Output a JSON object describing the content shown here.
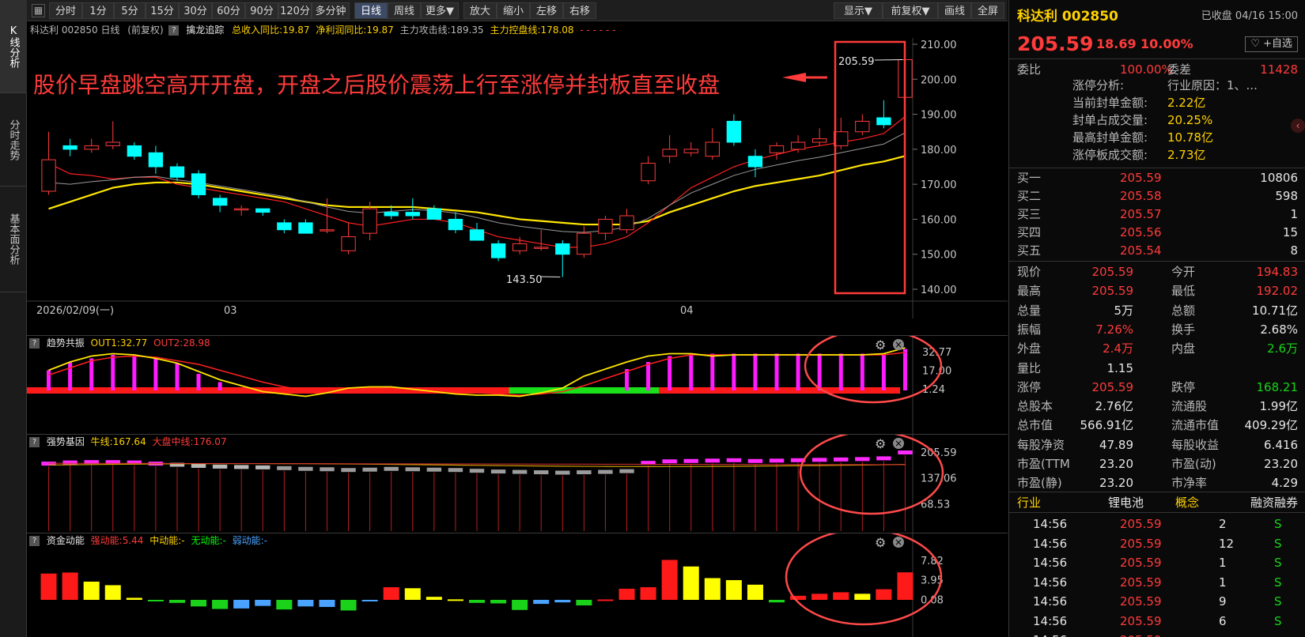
{
  "left_sidebar": [
    "K线分析",
    "分时走势",
    "基本面分析"
  ],
  "toolbar": {
    "items": [
      "分时",
      "1分",
      "5分",
      "15分",
      "30分",
      "60分",
      "90分",
      "120分",
      "多分钟",
      "日线",
      "周线",
      "更多▼",
      "放大",
      "缩小",
      "左移",
      "右移"
    ],
    "right_items": [
      "显示▼",
      "前复权▼",
      "画线",
      "全屏"
    ]
  },
  "chart_header": {
    "name": "科达利 002850 日线",
    "adj": "(前复权)",
    "indicator": "擒龙追踪",
    "rev": "总收入同比:19.87",
    "profit": "净利润同比:19.87",
    "atk": "主力攻击线:189.35",
    "ctrl": "主力控盘线:178.08",
    "dots": "- - - - - -"
  },
  "annotation": "股价早盘跳空高开开盘，开盘之后股价震荡上行至涨停并封板直至收盘",
  "price_axis": [
    "210.00",
    "200.00",
    "190.00",
    "180.00",
    "170.00",
    "160.00",
    "150.00",
    "140.00"
  ],
  "date_axis": [
    "2026/02/09(一)",
    "03",
    "04"
  ],
  "price_labels": {
    "last_high": "205.59",
    "low": "143.50"
  },
  "chart_data": [
    {
      "type": "candlestick",
      "name": "K线",
      "price_range": [
        140,
        210
      ],
      "candles": [
        [
          168,
          177,
          167,
          185
        ],
        [
          181,
          180,
          178,
          183
        ],
        [
          180,
          181,
          179,
          183
        ],
        [
          181,
          182,
          180,
          188
        ],
        [
          181,
          178,
          177,
          182
        ],
        [
          179,
          175,
          173,
          181
        ],
        [
          175,
          172,
          171,
          176
        ],
        [
          173,
          167,
          166,
          174
        ],
        [
          166,
          164,
          162,
          167
        ],
        [
          163,
          163,
          161,
          164
        ],
        [
          163,
          162,
          161,
          163
        ],
        [
          159,
          157,
          156,
          160
        ],
        [
          159,
          156,
          156,
          160
        ],
        [
          157,
          157,
          156,
          166
        ],
        [
          151,
          155,
          150,
          159
        ],
        [
          156,
          163,
          154,
          165
        ],
        [
          162,
          161,
          160,
          164
        ],
        [
          162,
          161,
          160,
          166
        ],
        [
          163,
          160,
          160,
          164
        ],
        [
          160,
          157,
          156,
          162
        ],
        [
          157,
          154,
          154,
          159
        ],
        [
          153,
          149,
          148,
          154
        ],
        [
          151,
          153,
          150,
          155
        ],
        [
          152,
          152,
          151,
          157
        ],
        [
          153,
          150,
          143.5,
          154
        ],
        [
          150,
          156,
          149,
          158
        ],
        [
          156,
          160,
          154,
          161
        ],
        [
          157,
          161,
          156,
          163
        ],
        [
          171,
          176,
          170,
          178
        ],
        [
          178,
          180,
          176,
          184
        ],
        [
          179,
          180,
          178,
          182
        ],
        [
          178,
          182,
          177,
          186
        ],
        [
          188,
          182,
          181,
          190
        ],
        [
          178,
          175,
          172,
          180
        ],
        [
          179,
          181,
          177,
          182
        ],
        [
          180,
          182,
          179,
          184
        ],
        [
          182,
          183,
          181,
          186
        ],
        [
          181,
          185,
          180,
          189
        ],
        [
          185,
          188,
          184,
          190
        ],
        [
          189,
          187,
          186,
          194
        ],
        [
          194.83,
          205.59,
          192.02,
          205.59
        ]
      ],
      "ma5": [
        176,
        173,
        172.5,
        171.5,
        172,
        172,
        170,
        169,
        168,
        167,
        166,
        165,
        163,
        161,
        159,
        158,
        159,
        160,
        160,
        159,
        157,
        155,
        154,
        153,
        152,
        152,
        153,
        155,
        159,
        164,
        169,
        172,
        175,
        177,
        178.5,
        180,
        181,
        182,
        183,
        184.5,
        189.35
      ],
      "ma_yellow": [
        163,
        165,
        167,
        169,
        170,
        170.5,
        170.5,
        170,
        169,
        168,
        167,
        166,
        165,
        164,
        163.5,
        163.5,
        163.5,
        163.5,
        163,
        162.5,
        162,
        161,
        160,
        159.5,
        159,
        158.5,
        158.5,
        158.5,
        159.5,
        162,
        164,
        166,
        168,
        169.5,
        170.5,
        171.5,
        172.5,
        174,
        175.5,
        176.5,
        178.08
      ]
    },
    {
      "type": "bar+line",
      "name": "趋势共振",
      "labels": [
        "OUT1:32.77",
        "OUT2:28.98"
      ],
      "axis": [
        "32.77",
        "17.00",
        "1.24"
      ],
      "bars": [
        17,
        24,
        27,
        30,
        29,
        27,
        23,
        14,
        7,
        0,
        0,
        0,
        0,
        0,
        0,
        0,
        0,
        0,
        0,
        0,
        0,
        0,
        0,
        0,
        0,
        0,
        0,
        18,
        24,
        29,
        31,
        31,
        31,
        31,
        31,
        31,
        31,
        31,
        31,
        31,
        35
      ],
      "out1": [
        17,
        24,
        29,
        31,
        30,
        27,
        23,
        16,
        9,
        4,
        -1,
        -3,
        -5,
        -2,
        2,
        3,
        3,
        1,
        -1,
        -3,
        -4,
        -4,
        -5,
        -2,
        2,
        12,
        18,
        24,
        29,
        31,
        31,
        29,
        30,
        30,
        30,
        30,
        30,
        30,
        30,
        31,
        36
      ],
      "out2": [
        13,
        19,
        25,
        28,
        29,
        28,
        25,
        22,
        17,
        12,
        7,
        3,
        0,
        -2,
        -1,
        1,
        2,
        2,
        1,
        -1,
        -2,
        -3,
        -4,
        -3,
        -1,
        4,
        10,
        16,
        22,
        27,
        30,
        30,
        30,
        30,
        30,
        30,
        30,
        30,
        30,
        30,
        32
      ],
      "green_segment": [
        22,
        28
      ]
    },
    {
      "type": "bar",
      "name": "强势基因",
      "labels": [
        "牛线:167.64",
        "大盘中线:176.07"
      ],
      "axis": [
        "205.59",
        "137.06",
        "68.53"
      ],
      "values": [
        176,
        179,
        180,
        180,
        179,
        176,
        173,
        170,
        168,
        167,
        166,
        164,
        162,
        161,
        159,
        160,
        162,
        161,
        160,
        159,
        157,
        155,
        154,
        153,
        152,
        153,
        154,
        156,
        178,
        182,
        183,
        184,
        185,
        183,
        184,
        185,
        186,
        187,
        188,
        190,
        205.59
      ]
    },
    {
      "type": "bar",
      "name": "资金动能",
      "labels": [
        "强动能:5.44",
        "中动能:-",
        "无动能:-",
        "弱动能:-"
      ],
      "axis": [
        "7.82",
        "3.95",
        "0.08"
      ],
      "values": [
        5.2,
        5.4,
        3.6,
        2.9,
        0.4,
        -0.2,
        -0.6,
        -1.3,
        -1.8,
        -1.7,
        -1.2,
        -1.9,
        -1.3,
        -1.4,
        -2.1,
        -0.3,
        2.5,
        2.3,
        0.6,
        0.1,
        -0.6,
        -0.7,
        -2.0,
        -0.8,
        -0.5,
        -1.1,
        0.08,
        2.2,
        2.5,
        7.9,
        6.6,
        4.3,
        3.9,
        3.0,
        -0.5,
        0.8,
        1.2,
        1.5,
        1.2,
        2.1,
        5.44
      ],
      "colors": [
        "r",
        "r",
        "y",
        "y",
        "y",
        "g",
        "g",
        "g",
        "g",
        "b",
        "b",
        "g",
        "b",
        "b",
        "g",
        "b",
        "r",
        "y",
        "y",
        "y",
        "g",
        "g",
        "g",
        "b",
        "b",
        "g",
        "r",
        "r",
        "r",
        "r",
        "y",
        "y",
        "y",
        "y",
        "g",
        "r",
        "r",
        "r",
        "y",
        "r",
        "r"
      ]
    }
  ],
  "quote": {
    "name": "科达利 002850",
    "status": "已收盘 04/16 15:00",
    "price": "205.59",
    "change": "18.69",
    "pct": "10.00%",
    "fav": "♡ +自选",
    "webi_label": "委比",
    "webi": "100.00%",
    "weicha_label": "委差",
    "weicha": "11428",
    "limit_analysis": [
      {
        "k": "涨停分析:",
        "v": "行业原因：1、..."
      },
      {
        "k": "当前封单金额:",
        "v": "2.22亿"
      },
      {
        "k": "封单占成交量:",
        "v": "20.25%"
      },
      {
        "k": "最高封单金额:",
        "v": "10.78亿"
      },
      {
        "k": "涨停板成交额:",
        "v": "2.73亿"
      }
    ],
    "bids": [
      {
        "k": "买一",
        "p": "205.59",
        "v": "10806"
      },
      {
        "k": "买二",
        "p": "205.58",
        "v": "598"
      },
      {
        "k": "买三",
        "p": "205.57",
        "v": "1"
      },
      {
        "k": "买四",
        "p": "205.56",
        "v": "15"
      },
      {
        "k": "买五",
        "p": "205.54",
        "v": "8"
      }
    ],
    "stats": [
      [
        "现价",
        "205.59",
        "今开",
        "194.83"
      ],
      [
        "最高",
        "205.59",
        "最低",
        "192.02"
      ],
      [
        "总量",
        "5万",
        "总额",
        "10.71亿"
      ],
      [
        "振幅",
        "7.26%",
        "换手",
        "2.68%"
      ],
      [
        "外盘",
        "2.4万",
        "内盘",
        "2.6万"
      ],
      [
        "量比",
        "1.15",
        "",
        ""
      ],
      [
        "涨停",
        "205.59",
        "跌停",
        "168.21"
      ],
      [
        "总股本",
        "2.76亿",
        "流通股",
        "1.99亿"
      ],
      [
        "总市值",
        "566.91亿",
        "流通市值",
        "409.29亿"
      ],
      [
        "每股净资",
        "47.89",
        "每股收益",
        "6.416"
      ],
      [
        "市盈(TTM",
        "23.20",
        "市盈(动)",
        "23.20"
      ],
      [
        "市盈(静)",
        "23.20",
        "市净率",
        "4.29"
      ]
    ],
    "tags": [
      "行业",
      "锂电池",
      "概念",
      "融资融券"
    ],
    "ticks": [
      [
        "14:56",
        "205.59",
        "2",
        "S"
      ],
      [
        "14:56",
        "205.59",
        "12",
        "S"
      ],
      [
        "14:56",
        "205.59",
        "1",
        "S"
      ],
      [
        "14:56",
        "205.59",
        "1",
        "S"
      ],
      [
        "14:56",
        "205.59",
        "9",
        "S"
      ],
      [
        "14:56",
        "205.59",
        "6",
        "S"
      ],
      [
        "14:56",
        "205.59",
        "",
        ""
      ]
    ]
  }
}
